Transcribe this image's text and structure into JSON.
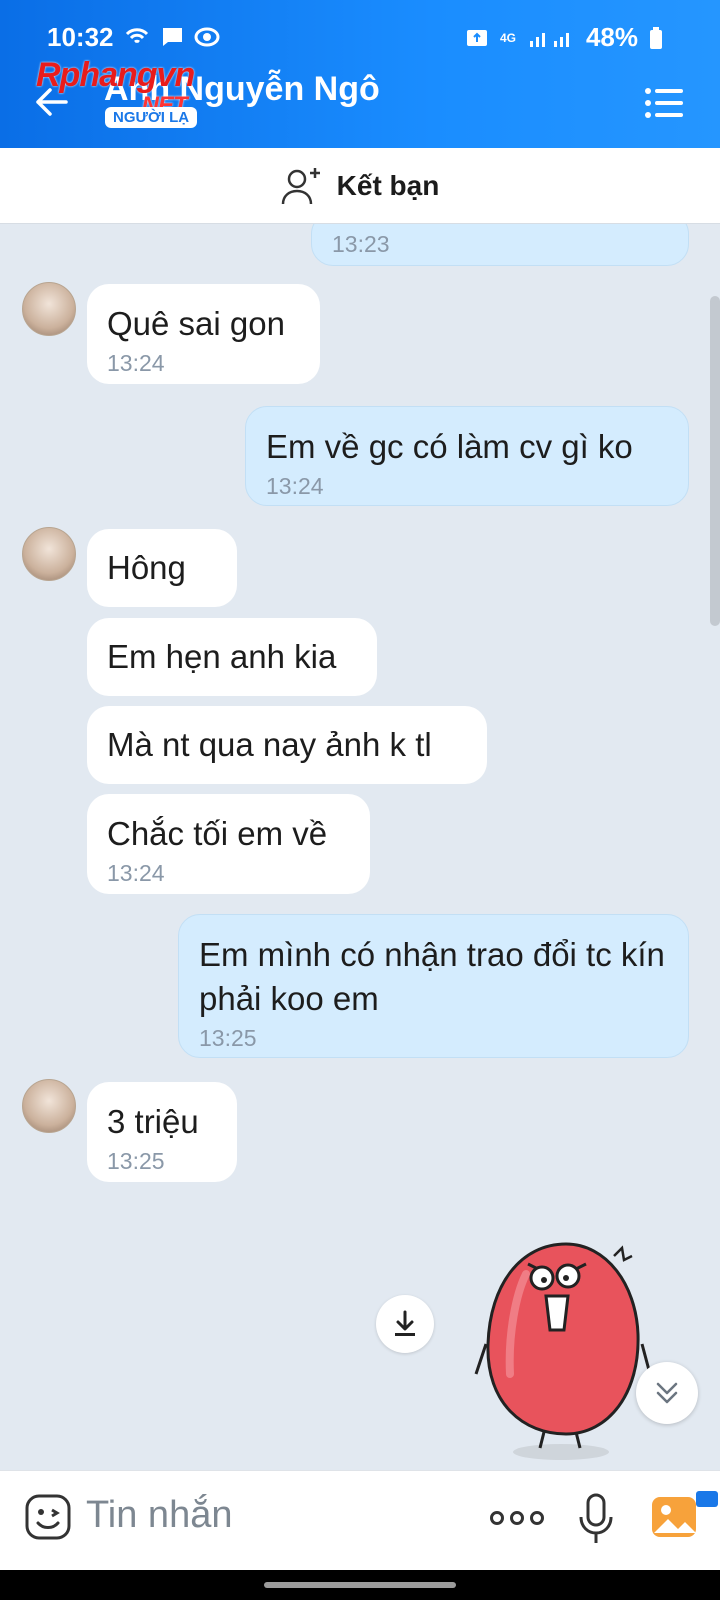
{
  "status": {
    "time": "10:32",
    "network": "4G",
    "battery": "48%"
  },
  "header": {
    "contact_name": "Anh Nguyễn Ngô",
    "stranger_badge": "NGƯỜI LẠ",
    "watermark": "Rphangvn",
    "watermark_suffix": ".NET"
  },
  "add_friend": {
    "label": "Kết bạn"
  },
  "messages": [
    {
      "side": "out",
      "text": "",
      "time": "13:23"
    },
    {
      "side": "in",
      "text": "Quê sai gon",
      "time": "13:24"
    },
    {
      "side": "out",
      "text": "Em về gc có làm cv gì ko",
      "time": "13:24"
    },
    {
      "side": "in",
      "text": "Hông",
      "time": ""
    },
    {
      "side": "in",
      "text": "Em hẹn anh kia",
      "time": ""
    },
    {
      "side": "in",
      "text": "Mà nt qua nay ảnh k tl",
      "time": ""
    },
    {
      "side": "in",
      "text": "Chắc tối em về",
      "time": "13:24"
    },
    {
      "side": "out",
      "text": "Em mình có nhận trao đổi tc kín phải koo em",
      "time": "13:25"
    },
    {
      "side": "in",
      "text": "3 triệu",
      "time": "13:25"
    }
  ],
  "composer": {
    "placeholder": "Tin nhắn"
  },
  "colors": {
    "header": "#1a8dff",
    "outgoing_bubble": "#d4ecfe",
    "incoming_bubble": "#ffffff",
    "chat_bg": "#e2e9f1",
    "sticker": "#e8535c"
  },
  "icons": [
    "back-arrow-icon",
    "menu-list-icon",
    "add-user-icon",
    "download-icon",
    "double-chevron-down-icon",
    "emoji-icon",
    "more-dots-icon",
    "microphone-icon",
    "image-icon"
  ]
}
